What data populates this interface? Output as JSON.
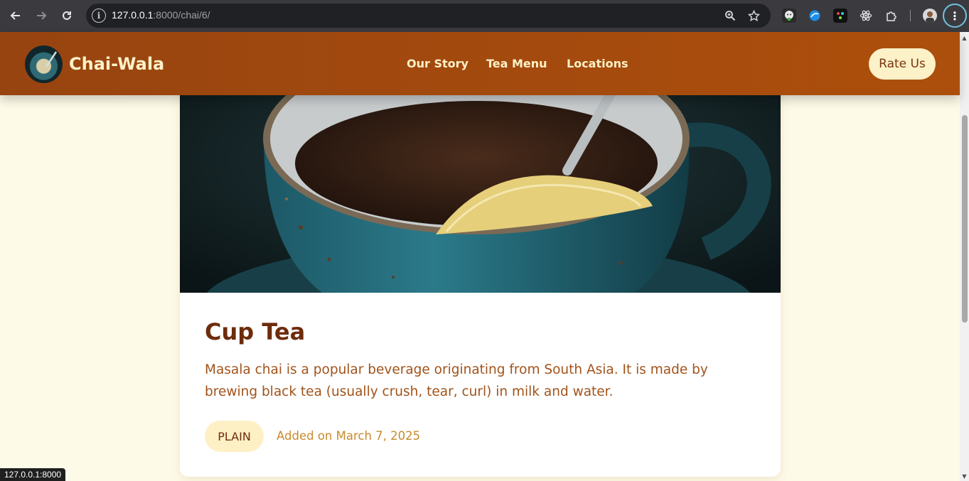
{
  "browser": {
    "url_host": "127.0.0.1",
    "url_path": ":8000/chai/6/",
    "status_url": "127.0.0.1:8000"
  },
  "site": {
    "brand": "Chai-Wala",
    "nav_links": [
      "Our Story",
      "Tea Menu",
      "Locations"
    ],
    "cta_label": "Rate Us"
  },
  "card": {
    "title": "Cup Tea",
    "description": "Masala chai is a popular beverage originating from South Asia. It is made by brewing black tea (usually crush, tear, curl) in milk and water.",
    "badge": "PLAIN",
    "added": "Added on March 7, 2025"
  },
  "colors": {
    "nav_background": "#ad4f0c",
    "page_background": "#fefae8",
    "accent_cream": "#fdf1c8",
    "title_brown": "#6e2c0c"
  },
  "icons": {
    "back": "arrow-left",
    "forward": "arrow-right",
    "reload": "reload",
    "site_info": "info",
    "zoom": "zoom",
    "bookmark": "star",
    "extensions": "puzzle",
    "menu": "kebab"
  }
}
